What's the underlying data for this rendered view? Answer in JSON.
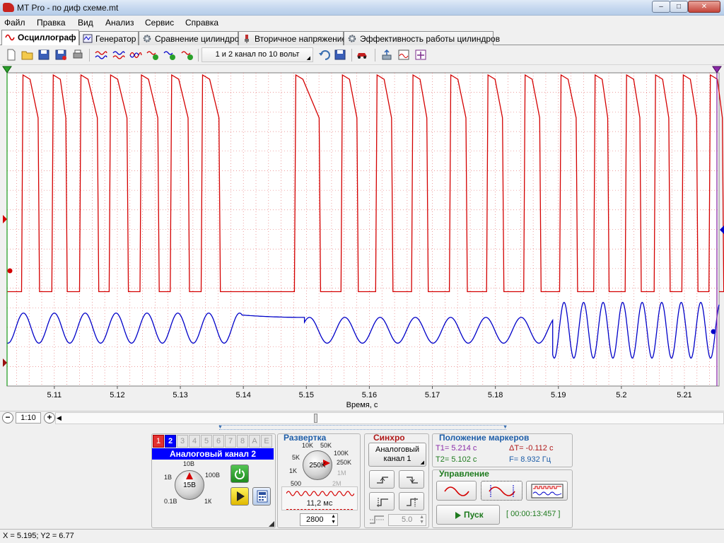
{
  "window": {
    "title": "MT Pro - по диф схеме.mt",
    "min": "–",
    "max": "□",
    "close": "✕"
  },
  "menu": [
    "Файл",
    "Правка",
    "Вид",
    "Анализ",
    "Сервис",
    "Справка"
  ],
  "tabs": [
    "Осциллограф",
    "Генератор",
    "Сравнение цилиндров",
    "Вторичное напряжение",
    "Эффективность работы цилиндров"
  ],
  "active_tab": "Осциллограф",
  "toolbar": {
    "preset": "1 и 2 канал по 10 вольт"
  },
  "colors": {
    "channel1": "#d40000",
    "channel2": "#0000c8",
    "grid": "#e06060",
    "accent_blue": "#0000ff",
    "green_button": "#28a028"
  },
  "plot": {
    "x_label": "Время, с",
    "x_ticks": [
      "5.11",
      "5.12",
      "5.13",
      "5.14",
      "5.15",
      "5.16",
      "5.17",
      "5.18",
      "5.19",
      "5.2",
      "5.21"
    ]
  },
  "chart_data": {
    "type": "line",
    "xlabel": "Время, с",
    "ylabel": "",
    "xlim": [
      5.1025,
      5.2155
    ],
    "grid": true,
    "series": [
      {
        "name": "1",
        "color": "#d40000",
        "shape": "square",
        "low": -1.45,
        "high": 3.0,
        "pulses": [
          [
            5.1048,
            5.1081
          ],
          [
            5.1096,
            5.1125
          ],
          [
            5.114,
            5.1175
          ],
          [
            5.1187,
            5.1222
          ],
          [
            5.1236,
            5.1271
          ],
          [
            5.1284,
            5.1319
          ],
          [
            5.1333,
            5.1368
          ],
          [
            5.1481,
            5.1527
          ],
          [
            5.1555,
            5.1587
          ],
          [
            5.161,
            5.1642
          ],
          [
            5.1667,
            5.1698
          ],
          [
            5.1727,
            5.176
          ],
          [
            5.1786,
            5.1818
          ],
          [
            5.1845,
            5.1877
          ],
          [
            5.1902,
            5.1935
          ],
          [
            5.1956,
            5.1985
          ],
          [
            5.2006,
            5.2036
          ],
          [
            5.2052,
            5.2082
          ],
          [
            5.2096,
            5.2126
          ],
          [
            5.2139,
            5.2167
          ]
        ]
      },
      {
        "name": "2",
        "color": "#0000c8",
        "shape": "sine",
        "segments": [
          {
            "t0": 5.1025,
            "t1": 5.1398,
            "period": 0.0049,
            "phase": 5.1051,
            "amp": 0.35,
            "offset": -2.3
          },
          {
            "t0": 5.1398,
            "t1": 5.1497,
            "ramp_to": -2.05
          },
          {
            "t0": 5.1497,
            "t1": 5.1891,
            "period": 0.0056,
            "phase": 5.1505,
            "amp": 0.3,
            "offset": -2.35
          },
          {
            "t0": 5.1891,
            "t1": 5.2155,
            "period": 0.0031,
            "phase": 5.1909,
            "amp": 0.65,
            "offset": -2.35
          }
        ]
      }
    ]
  },
  "scroll": {
    "zoom": "1:10",
    "minus": "−",
    "plus": "+",
    "left_arrow": "◀"
  },
  "channels": {
    "tabs": [
      "1",
      "2",
      "3",
      "4",
      "5",
      "6",
      "7",
      "8",
      "A",
      "E"
    ],
    "selected": "2",
    "title": "Аналоговый канал 2",
    "range_knob": {
      "value": "15В",
      "labels": [
        "10В",
        "1В",
        "100В",
        "0.1В",
        "1К"
      ]
    }
  },
  "sweep": {
    "title": "Развертка",
    "knob": {
      "value": "250K",
      "labels": [
        "10K",
        "50K",
        "5K",
        "100K",
        "250K",
        "1K",
        "1M",
        "500",
        "2M"
      ]
    },
    "time": "11,2 мс",
    "points": "2800"
  },
  "sync": {
    "title": "Синхро",
    "source": "Аналоговый канал 1",
    "level": "5.0"
  },
  "markers": {
    "title": "Положение маркеров",
    "t1": "T1= 5.214 с",
    "t2": "T2= 5.102 с",
    "dt": "ΔT= -0.112 с",
    "f": "F= 8.932 Гц"
  },
  "control": {
    "title": "Управление",
    "start": "Пуск",
    "timer": "[ 00:00:13:457 ]"
  },
  "status": {
    "text": "X = 5.195; Y2 = 6.77"
  }
}
